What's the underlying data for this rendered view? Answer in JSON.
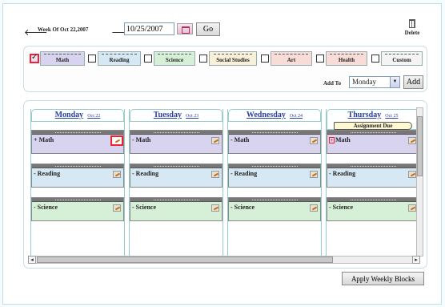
{
  "toolbar": {
    "prev_arrow": "🡐",
    "next_arrow": "🡒",
    "week_label": "Week Of Oct 22,2007",
    "date_value": "10/25/2007",
    "go_label": "Go",
    "delete_label": "Delete"
  },
  "blocks": [
    {
      "label": "Math",
      "color": "#d8d4f0",
      "checked": true
    },
    {
      "label": "Reading",
      "color": "#d6e8f4",
      "checked": false
    },
    {
      "label": "Science",
      "color": "#d6f0d8",
      "checked": false
    },
    {
      "label": "Social Studies",
      "color": "#f8f0d8",
      "checked": false
    },
    {
      "label": "Art",
      "color": "#f8dcd8",
      "checked": false
    },
    {
      "label": "Health",
      "color": "#f8dcd8",
      "checked": false
    },
    {
      "label": "Custom",
      "color": "#f4f4f4",
      "checked": false
    }
  ],
  "add_to": {
    "label": "Add To",
    "selected": "Monday",
    "button": "Add"
  },
  "days": [
    {
      "name": "Monday",
      "date": "Oct 22",
      "items": [
        "Math",
        "Reading",
        "Science"
      ]
    },
    {
      "name": "Tuesday",
      "date": "Oct 23",
      "items": [
        "Math",
        "Reading",
        "Science"
      ]
    },
    {
      "name": "Wednesday",
      "date": "Oct 24",
      "items": [
        "Math",
        "Reading",
        "Science"
      ]
    },
    {
      "name": "Thursday",
      "date": "Oct 25",
      "items": [
        "Math",
        "Reading",
        "Science"
      ],
      "due_label": "Assignment Due"
    }
  ],
  "apply_label": "Apply Weekly Blocks"
}
